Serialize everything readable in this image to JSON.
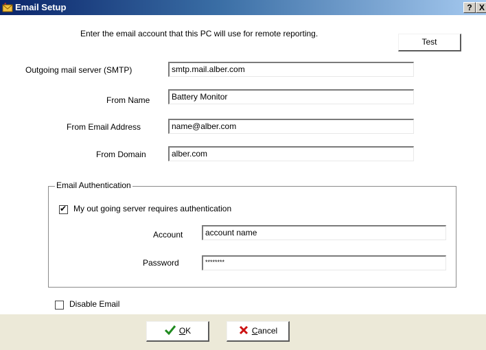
{
  "window": {
    "title": "Email Setup",
    "help_glyph": "?",
    "close_glyph": "X"
  },
  "intro": "Enter the email account that this PC will use for remote reporting.",
  "test_button": "Test",
  "fields": {
    "smtp": {
      "label": "Outgoing mail server (SMTP)",
      "value": "smtp.mail.alber.com"
    },
    "from_name": {
      "label": "From Name",
      "value": "Battery Monitor"
    },
    "from_email": {
      "label": "From Email Address",
      "value": "name@alber.com"
    },
    "from_domain": {
      "label": "From Domain",
      "value": "alber.com"
    }
  },
  "auth": {
    "legend": "Email Authentication",
    "requires_auth_label": "My out going server requires authentication",
    "requires_auth_checked": true,
    "account": {
      "label": "Account",
      "value": "account name"
    },
    "password": {
      "label": "Password",
      "value": "********"
    }
  },
  "disable_email": {
    "label": "Disable Email",
    "checked": false
  },
  "buttons": {
    "ok": {
      "mnemonic": "O",
      "rest": "K"
    },
    "cancel": {
      "mnemonic": "C",
      "rest": "ancel"
    }
  },
  "colors": {
    "titlebar_start": "#0a246a",
    "titlebar_end": "#a6caf0",
    "ok_check": "#1f8a1f",
    "cancel_x": "#cc1111"
  },
  "icons": [
    "app-icon",
    "help-icon",
    "close-icon",
    "check-icon",
    "x-icon"
  ]
}
